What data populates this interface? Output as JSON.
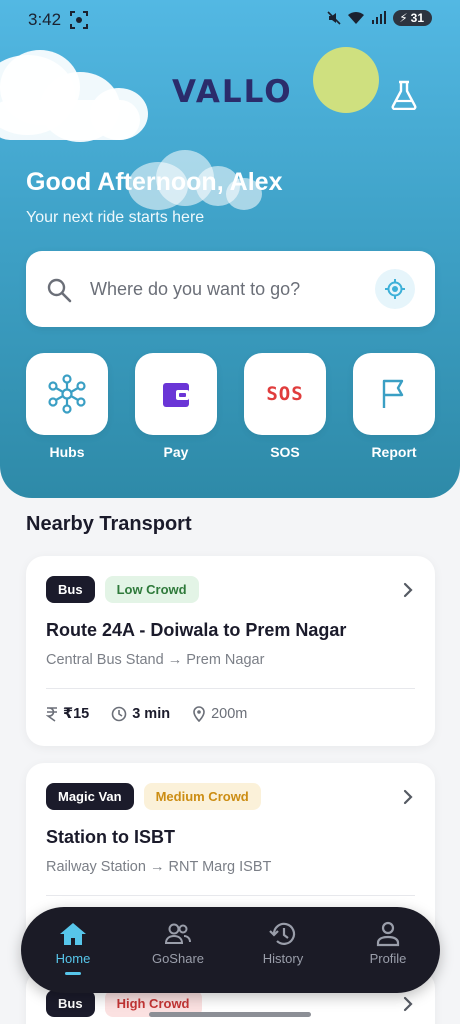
{
  "status_bar": {
    "time": "3:42",
    "battery": "31"
  },
  "header": {
    "logo": "VALLO",
    "greeting": "Good Afternoon, Alex",
    "subtitle": "Your next ride starts here"
  },
  "search": {
    "placeholder": "Where do you want to go?"
  },
  "quick_actions": [
    {
      "label": "Hubs",
      "icon": "hub-network-icon"
    },
    {
      "label": "Pay",
      "icon": "wallet-icon"
    },
    {
      "label": "SOS",
      "icon": "sos-icon",
      "icon_text": "SOS"
    },
    {
      "label": "Report",
      "icon": "flag-icon"
    }
  ],
  "section_title": "Nearby Transport",
  "cards": [
    {
      "type": "Bus",
      "crowd": "Low Crowd",
      "title": "Route 24A - Doiwala to Prem Nagar",
      "from": "Central Bus Stand",
      "to": "Prem Nagar",
      "fare": "₹15",
      "eta": "3 min",
      "distance": "200m"
    },
    {
      "type": "Magic Van",
      "crowd": "Medium Crowd",
      "title": "Station to ISBT",
      "from": "Railway Station",
      "to": "RNT Marg ISBT"
    },
    {
      "type": "Bus",
      "crowd": "High Crowd"
    }
  ],
  "route_arrow": "→",
  "nav": [
    {
      "label": "Home",
      "active": true
    },
    {
      "label": "GoShare"
    },
    {
      "label": "History"
    },
    {
      "label": "Profile"
    }
  ],
  "colors": {
    "accent": "#57c6ea",
    "brand": "#2b2c6b",
    "nav_bg": "#1b1b26",
    "sos_red": "#e03d3d"
  }
}
